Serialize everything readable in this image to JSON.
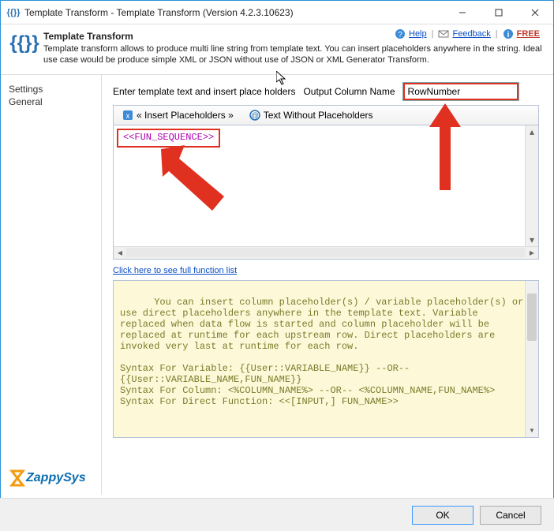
{
  "window": {
    "title": "Template Transform - Template Transform (Version 4.2.3.10623)"
  },
  "header": {
    "icon_text": "{{}}",
    "title": "Template Transform",
    "subtitle": "Template transform allows to produce multi line string from template text. You can insert placeholders anywhere in the string. Ideal use case would be produce simple XML or JSON without use of JSON or XML Generator Transform."
  },
  "help_links": {
    "help": "Help",
    "feedback": "Feedback",
    "free": "FREE"
  },
  "sidebar": {
    "items": [
      {
        "label": "Settings"
      },
      {
        "label": "General"
      }
    ],
    "logo_z": "Z",
    "logo_rest": "ZappySys"
  },
  "content": {
    "enter_label": "Enter template text and insert place holders",
    "output_label": "Output Column Name",
    "output_value": "RowNumber",
    "toolbar": {
      "insert_label": "« Insert Placeholders »",
      "textwo_label": "Text Without Placeholders"
    },
    "editor_text": "<<FUN_SEQUENCE>>",
    "full_list_link": "Click here to see full function list",
    "info_text": "You can insert column placeholder(s) / variable placeholder(s) or use direct placeholders anywhere in the template text. Variable replaced when data flow is started and column placeholder will be replaced at runtime for each upstream row. Direct placeholders are invoked very last at runtime for each row.\n\nSyntax For Variable: {{User::VARIABLE_NAME}} --OR-- {{User::VARIABLE_NAME,FUN_NAME}}\nSyntax For Column: <%COLUMN_NAME%> --OR-- <%COLUMN_NAME,FUN_NAME%>\nSyntax For Direct Function: <<[INPUT,] FUN_NAME>>"
  },
  "footer": {
    "ok": "OK",
    "cancel": "Cancel"
  }
}
